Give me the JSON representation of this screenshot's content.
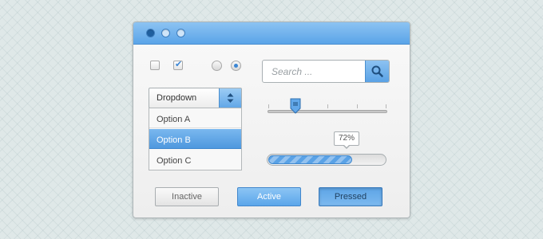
{
  "window": {
    "controls": [
      {
        "name": "window-control-1",
        "state": "active"
      },
      {
        "name": "window-control-2",
        "state": "inactive"
      },
      {
        "name": "window-control-3",
        "state": "inactive"
      }
    ]
  },
  "checkboxes": [
    {
      "checked": false
    },
    {
      "checked": true,
      "glyph": "✔"
    }
  ],
  "radios": [
    {
      "selected": false
    },
    {
      "selected": true
    }
  ],
  "search": {
    "placeholder": "Search ...",
    "icon": "search-icon"
  },
  "dropdown": {
    "label": "Dropdown",
    "icon": "up-down-arrows-icon",
    "options": [
      {
        "label": "Option A",
        "selected": false
      },
      {
        "label": "Option B",
        "selected": true
      },
      {
        "label": "Option C",
        "selected": false
      }
    ]
  },
  "slider": {
    "value": 0.23,
    "icon": "grip-icon"
  },
  "progress": {
    "value": 0.72,
    "label": "72%"
  },
  "buttons": {
    "inactive": "Inactive",
    "active": "Active",
    "pressed": "Pressed"
  },
  "colors": {
    "accent": "#5aa2e6",
    "accent_dark": "#3f88cf",
    "background": "#dfe8e8"
  }
}
